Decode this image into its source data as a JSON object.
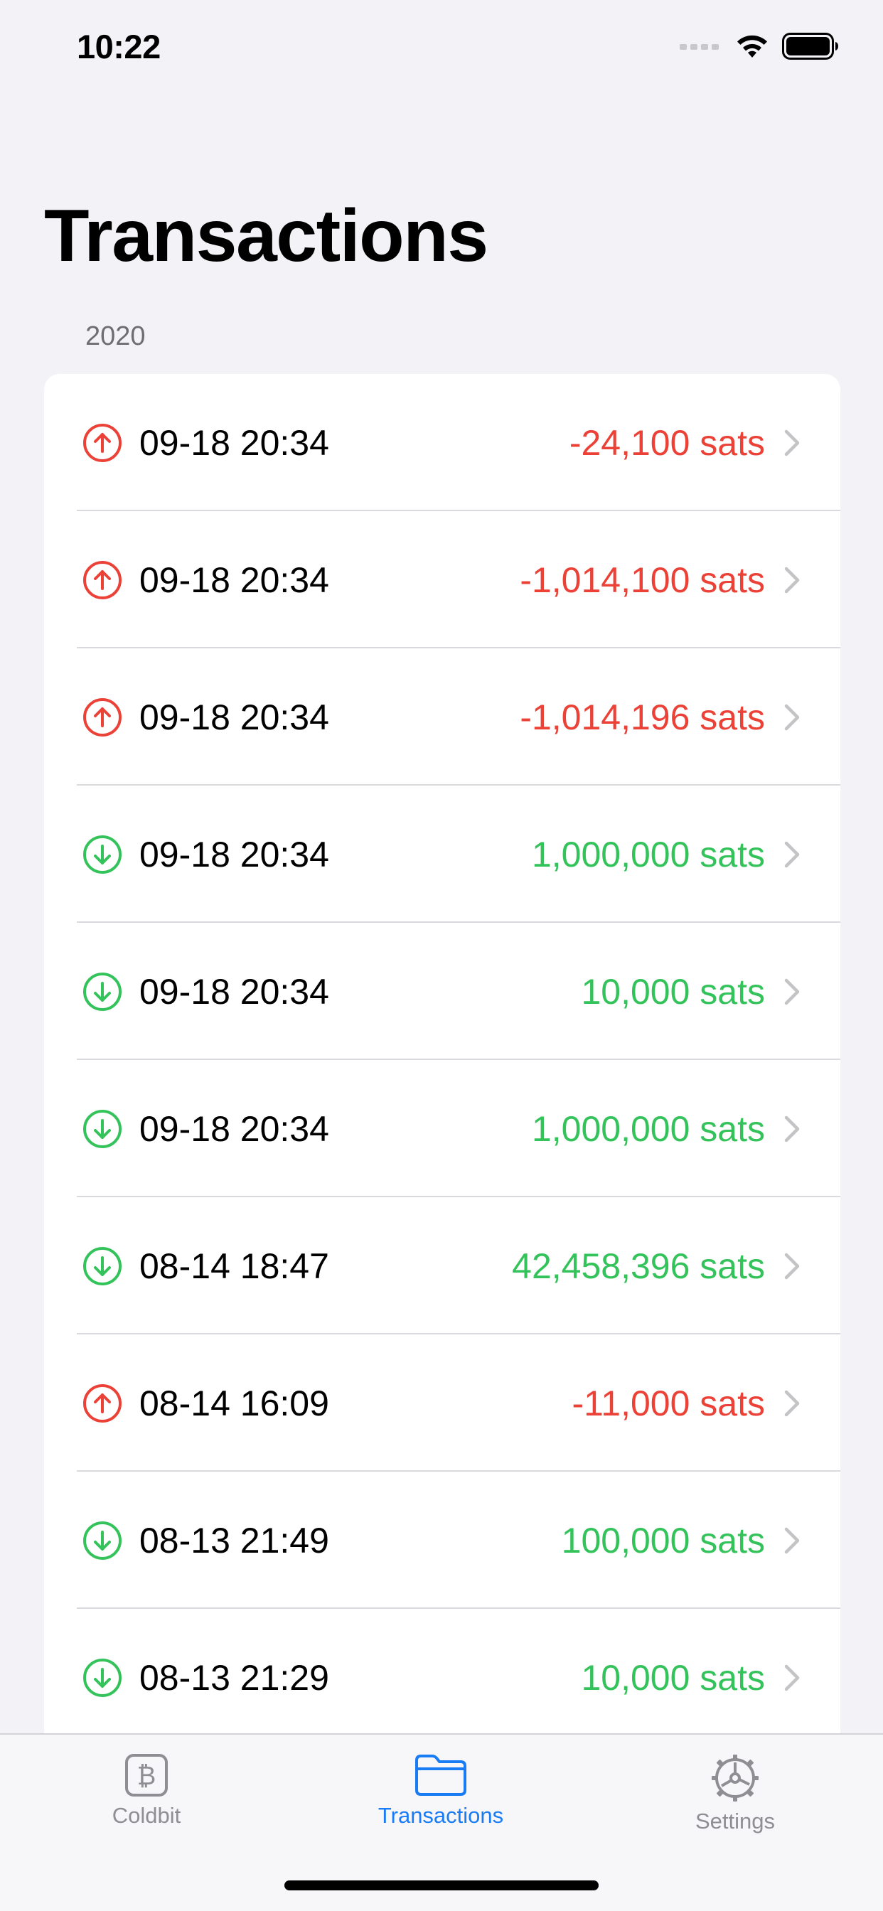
{
  "status_bar": {
    "time": "10:22"
  },
  "page": {
    "title": "Transactions",
    "section": "2020"
  },
  "colors": {
    "outgoing": "#eb4137",
    "incoming": "#34c35a",
    "accent": "#1a7cf5"
  },
  "transactions": [
    {
      "direction": "out",
      "icon": "arrow-up-circle-icon",
      "date": "09-18 20:34",
      "amount": "-24,100 sats"
    },
    {
      "direction": "out",
      "icon": "arrow-up-circle-icon",
      "date": "09-18 20:34",
      "amount": "-1,014,100 sats"
    },
    {
      "direction": "out",
      "icon": "arrow-up-circle-icon",
      "date": "09-18 20:34",
      "amount": "-1,014,196 sats"
    },
    {
      "direction": "in",
      "icon": "arrow-down-circle-icon",
      "date": "09-18 20:34",
      "amount": "1,000,000 sats"
    },
    {
      "direction": "in",
      "icon": "arrow-down-circle-icon",
      "date": "09-18 20:34",
      "amount": "10,000 sats"
    },
    {
      "direction": "in",
      "icon": "arrow-down-circle-icon",
      "date": "09-18 20:34",
      "amount": "1,000,000 sats"
    },
    {
      "direction": "in",
      "icon": "arrow-down-circle-icon",
      "date": "08-14 18:47",
      "amount": "42,458,396 sats"
    },
    {
      "direction": "out",
      "icon": "arrow-up-circle-icon",
      "date": "08-14 16:09",
      "amount": "-11,000 sats"
    },
    {
      "direction": "in",
      "icon": "arrow-down-circle-icon",
      "date": "08-13 21:49",
      "amount": "100,000 sats"
    },
    {
      "direction": "in",
      "icon": "arrow-down-circle-icon",
      "date": "08-13 21:29",
      "amount": "10,000 sats"
    }
  ],
  "tab_bar": {
    "tabs": [
      {
        "label": "Coldbit",
        "icon": "bitcoin-square-icon",
        "active": false
      },
      {
        "label": "Transactions",
        "icon": "folder-icon",
        "active": true
      },
      {
        "label": "Settings",
        "icon": "gear-icon",
        "active": false
      }
    ]
  }
}
